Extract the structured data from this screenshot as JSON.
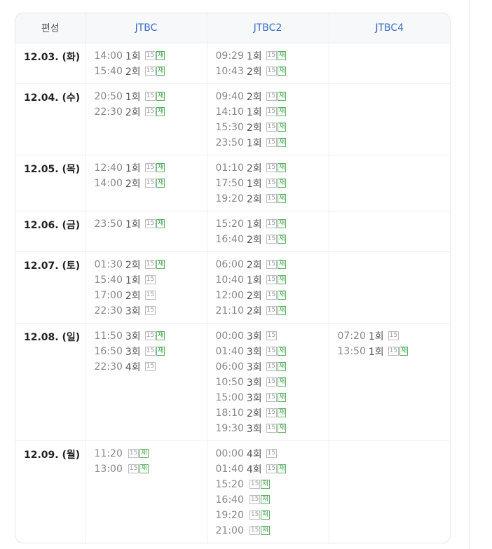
{
  "header": {
    "date_label": "편성",
    "channels": [
      "JTBC",
      "JTBC2",
      "JTBC4"
    ]
  },
  "schedule": [
    {
      "date": "12.03. (화)",
      "height": 58,
      "channels": [
        [
          {
            "time": "14:00",
            "ep": "1회",
            "age": "15",
            "re": "재"
          },
          {
            "time": "15:40",
            "ep": "2회",
            "age": "15",
            "re": "재"
          }
        ],
        [
          {
            "time": "09:29",
            "ep": "1회",
            "age": "15",
            "re": "재"
          },
          {
            "time": "10:43",
            "ep": "2회",
            "age": "15",
            "re": "재"
          }
        ],
        []
      ]
    },
    {
      "date": "12.04. (수)",
      "height": 102,
      "channels": [
        [
          {
            "time": "20:50",
            "ep": "1회",
            "age": "15",
            "re": "재"
          },
          {
            "time": "22:30",
            "ep": "2회",
            "age": "15",
            "re": "재"
          }
        ],
        [
          {
            "time": "09:40",
            "ep": "2회",
            "age": "15",
            "re": "재"
          },
          {
            "time": "14:10",
            "ep": "1회",
            "age": "15",
            "re": "재"
          },
          {
            "time": "15:30",
            "ep": "2회",
            "age": "15",
            "re": "재"
          },
          {
            "time": "23:50",
            "ep": "1회",
            "age": "15",
            "re": "재"
          }
        ],
        []
      ]
    },
    {
      "date": "12.05. (목)",
      "height": 80,
      "channels": [
        [
          {
            "time": "12:40",
            "ep": "1회",
            "age": "15",
            "re": "재"
          },
          {
            "time": "14:00",
            "ep": "2회",
            "age": "15",
            "re": "재"
          }
        ],
        [
          {
            "time": "01:10",
            "ep": "2회",
            "age": "15",
            "re": "재"
          },
          {
            "time": "17:50",
            "ep": "1회",
            "age": "15",
            "re": "재"
          },
          {
            "time": "19:20",
            "ep": "2회",
            "age": "15",
            "re": "재"
          }
        ],
        []
      ]
    },
    {
      "date": "12.06. (금)",
      "height": 58,
      "channels": [
        [
          {
            "time": "23:50",
            "ep": "1회",
            "age": "15",
            "re": "재"
          }
        ],
        [
          {
            "time": "15:20",
            "ep": "1회",
            "age": "15",
            "re": "재"
          },
          {
            "time": "16:40",
            "ep": "2회",
            "age": "15",
            "re": "재"
          }
        ],
        []
      ]
    },
    {
      "date": "12.07. (토)",
      "height": 102,
      "channels": [
        [
          {
            "time": "01:30",
            "ep": "2회",
            "age": "15",
            "re": "재"
          },
          {
            "time": "15:40",
            "ep": "1회",
            "age": "15",
            "re": ""
          },
          {
            "time": "17:00",
            "ep": "2회",
            "age": "15",
            "re": ""
          },
          {
            "time": "22:30",
            "ep": "3회",
            "age": "15",
            "re": ""
          }
        ],
        [
          {
            "time": "06:00",
            "ep": "2회",
            "age": "15",
            "re": "재"
          },
          {
            "time": "10:40",
            "ep": "1회",
            "age": "15",
            "re": "재"
          },
          {
            "time": "12:00",
            "ep": "2회",
            "age": "15",
            "re": "재"
          },
          {
            "time": "21:10",
            "ep": "2회",
            "age": "15",
            "re": "재"
          }
        ],
        []
      ]
    },
    {
      "date": "12.08. (일)",
      "height": 168,
      "channels": [
        [
          {
            "time": "11:50",
            "ep": "3회",
            "age": "15",
            "re": "재"
          },
          {
            "time": "16:50",
            "ep": "3회",
            "age": "15",
            "re": "재"
          },
          {
            "time": "22:30",
            "ep": "4회",
            "age": "15",
            "re": ""
          }
        ],
        [
          {
            "time": "00:00",
            "ep": "3회",
            "age": "15",
            "re": ""
          },
          {
            "time": "01:40",
            "ep": "3회",
            "age": "15",
            "re": "재"
          },
          {
            "time": "06:00",
            "ep": "3회",
            "age": "15",
            "re": "재"
          },
          {
            "time": "10:50",
            "ep": "3회",
            "age": "15",
            "re": "재"
          },
          {
            "time": "15:00",
            "ep": "3회",
            "age": "15",
            "re": "재"
          },
          {
            "time": "18:10",
            "ep": "2회",
            "age": "15",
            "re": "재"
          },
          {
            "time": "19:30",
            "ep": "3회",
            "age": "15",
            "re": "재"
          }
        ],
        [
          {
            "time": "07:20",
            "ep": "1회",
            "age": "15",
            "re": ""
          },
          {
            "time": "13:50",
            "ep": "1회",
            "age": "15",
            "re": "재"
          }
        ]
      ]
    },
    {
      "date": "12.09. (월)",
      "height": 146,
      "channels": [
        [
          {
            "time": "11:20",
            "ep": "",
            "age": "15",
            "re": "재"
          },
          {
            "time": "13:00",
            "ep": "",
            "age": "15",
            "re": "재"
          }
        ],
        [
          {
            "time": "00:00",
            "ep": "4회",
            "age": "15",
            "re": ""
          },
          {
            "time": "01:40",
            "ep": "4회",
            "age": "15",
            "re": "재"
          },
          {
            "time": "15:20",
            "ep": "",
            "age": "15",
            "re": "재"
          },
          {
            "time": "16:40",
            "ep": "",
            "age": "15",
            "re": "재"
          },
          {
            "time": "19:20",
            "ep": "",
            "age": "15",
            "re": "재"
          },
          {
            "time": "21:00",
            "ep": "",
            "age": "15",
            "re": "재"
          }
        ],
        []
      ]
    }
  ]
}
